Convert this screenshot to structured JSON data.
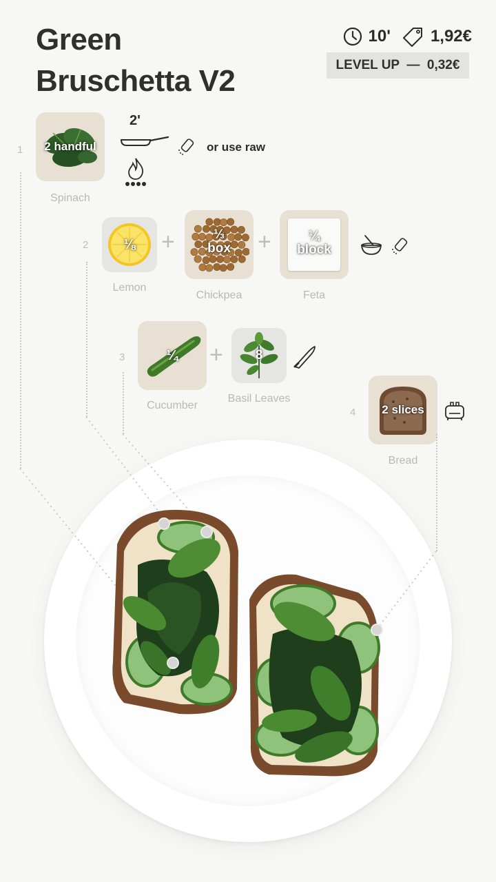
{
  "header": {
    "title_line1": "Green",
    "title_line2": "Bruschetta V2",
    "time": "10'",
    "price": "1,92€",
    "level_up": "LEVEL UP  —  0,32€"
  },
  "steps": [
    {
      "number": "1",
      "ingredients": [
        {
          "name": "Spinach",
          "qty": "2 handful"
        }
      ],
      "cook_time": "2'",
      "note": "or use raw",
      "icons": [
        "frying-pan-icon",
        "flame-icon",
        "salt-shaker-icon"
      ]
    },
    {
      "number": "2",
      "ingredients": [
        {
          "name": "Lemon",
          "qty": "⅛"
        },
        {
          "name": "Chickpea",
          "qty": "⅓",
          "unit": "box"
        },
        {
          "name": "Feta",
          "qty": "¼",
          "unit": "block"
        }
      ],
      "icons": [
        "mixing-bowl-icon",
        "salt-shaker-icon"
      ]
    },
    {
      "number": "3",
      "ingredients": [
        {
          "name": "Cucumber",
          "qty": "¼"
        },
        {
          "name": "Basil Leaves",
          "qty": "8"
        }
      ],
      "icons": [
        "knife-icon"
      ]
    },
    {
      "number": "4",
      "ingredients": [
        {
          "name": "Bread",
          "qty": "2 slices"
        }
      ],
      "icons": [
        "toaster-icon"
      ]
    }
  ],
  "colors": {
    "background": "#f7f7f5",
    "tile_beige": "#e8e0d2",
    "tile_grey": "#e5e5e3",
    "label_grey": "#b8b8b6",
    "spinach_green": "#2e5a2a",
    "lemon_yellow": "#f3c623",
    "chickpea": "#b07b3e",
    "bread_crust": "#7a4a2c"
  }
}
